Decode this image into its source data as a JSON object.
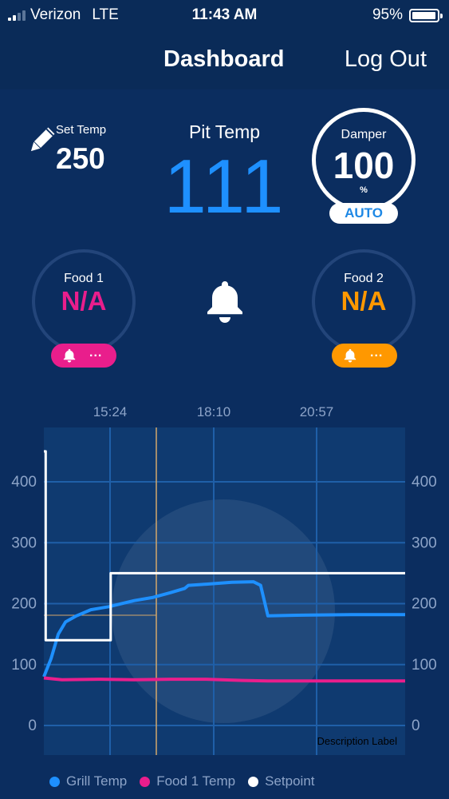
{
  "status_bar": {
    "carrier": "Verizon",
    "network": "LTE",
    "time": "11:43 AM",
    "battery": "95%",
    "battery_level": 0.95
  },
  "nav": {
    "title": "Dashboard",
    "logout_label": "Log Out"
  },
  "set_temp": {
    "label": "Set Temp",
    "value": "250"
  },
  "pit_temp": {
    "label": "Pit Temp",
    "value": "111"
  },
  "damper": {
    "label": "Damper",
    "value": "100",
    "unit": "%",
    "mode": "AUTO"
  },
  "food1": {
    "label": "Food 1",
    "value": "N/A",
    "color": "#e91e8c",
    "dots": "..."
  },
  "food2": {
    "label": "Food  2",
    "value": "N/A",
    "color": "#ff9800",
    "dots": "..."
  },
  "colors": {
    "accent": "#1e90ff",
    "background": "#0b2d5f",
    "food1": "#e91e8c",
    "food2": "#ff9800"
  },
  "chart_data": {
    "type": "line",
    "x_ticks": [
      "15:24",
      "18:10",
      "20:57"
    ],
    "y_ticks": [
      "400",
      "300",
      "200",
      "100",
      "0"
    ],
    "ylim": [
      0,
      450
    ],
    "description_label": "Description Label",
    "grid": true,
    "legend_position": "bottom",
    "series": [
      {
        "name": "Grill Temp",
        "color": "#1e90ff",
        "points": [
          [
            0,
            80
          ],
          [
            2,
            110
          ],
          [
            4,
            150
          ],
          [
            6,
            170
          ],
          [
            9,
            180
          ],
          [
            13,
            190
          ],
          [
            18,
            195
          ],
          [
            25,
            205
          ],
          [
            30,
            210
          ],
          [
            35,
            218
          ],
          [
            39,
            225
          ],
          [
            40,
            230
          ],
          [
            45,
            232
          ],
          [
            52,
            235
          ],
          [
            58,
            236
          ],
          [
            60,
            230
          ],
          [
            62,
            180
          ],
          [
            70,
            181
          ],
          [
            85,
            182
          ],
          [
            100,
            182
          ]
        ]
      },
      {
        "name": "Food 1 Temp",
        "color": "#e91e8c",
        "points": [
          [
            0,
            78
          ],
          [
            5,
            75
          ],
          [
            15,
            76
          ],
          [
            25,
            75
          ],
          [
            35,
            76
          ],
          [
            45,
            76
          ],
          [
            55,
            74
          ],
          [
            62,
            73
          ],
          [
            75,
            73
          ],
          [
            100,
            73
          ]
        ]
      },
      {
        "name": "Setpoint",
        "color": "#ffffff",
        "points": [
          [
            0,
            450
          ],
          [
            0.5,
            450
          ],
          [
            0.5,
            140
          ],
          [
            18.5,
            140
          ],
          [
            18.5,
            250
          ],
          [
            100,
            250
          ]
        ]
      }
    ]
  }
}
